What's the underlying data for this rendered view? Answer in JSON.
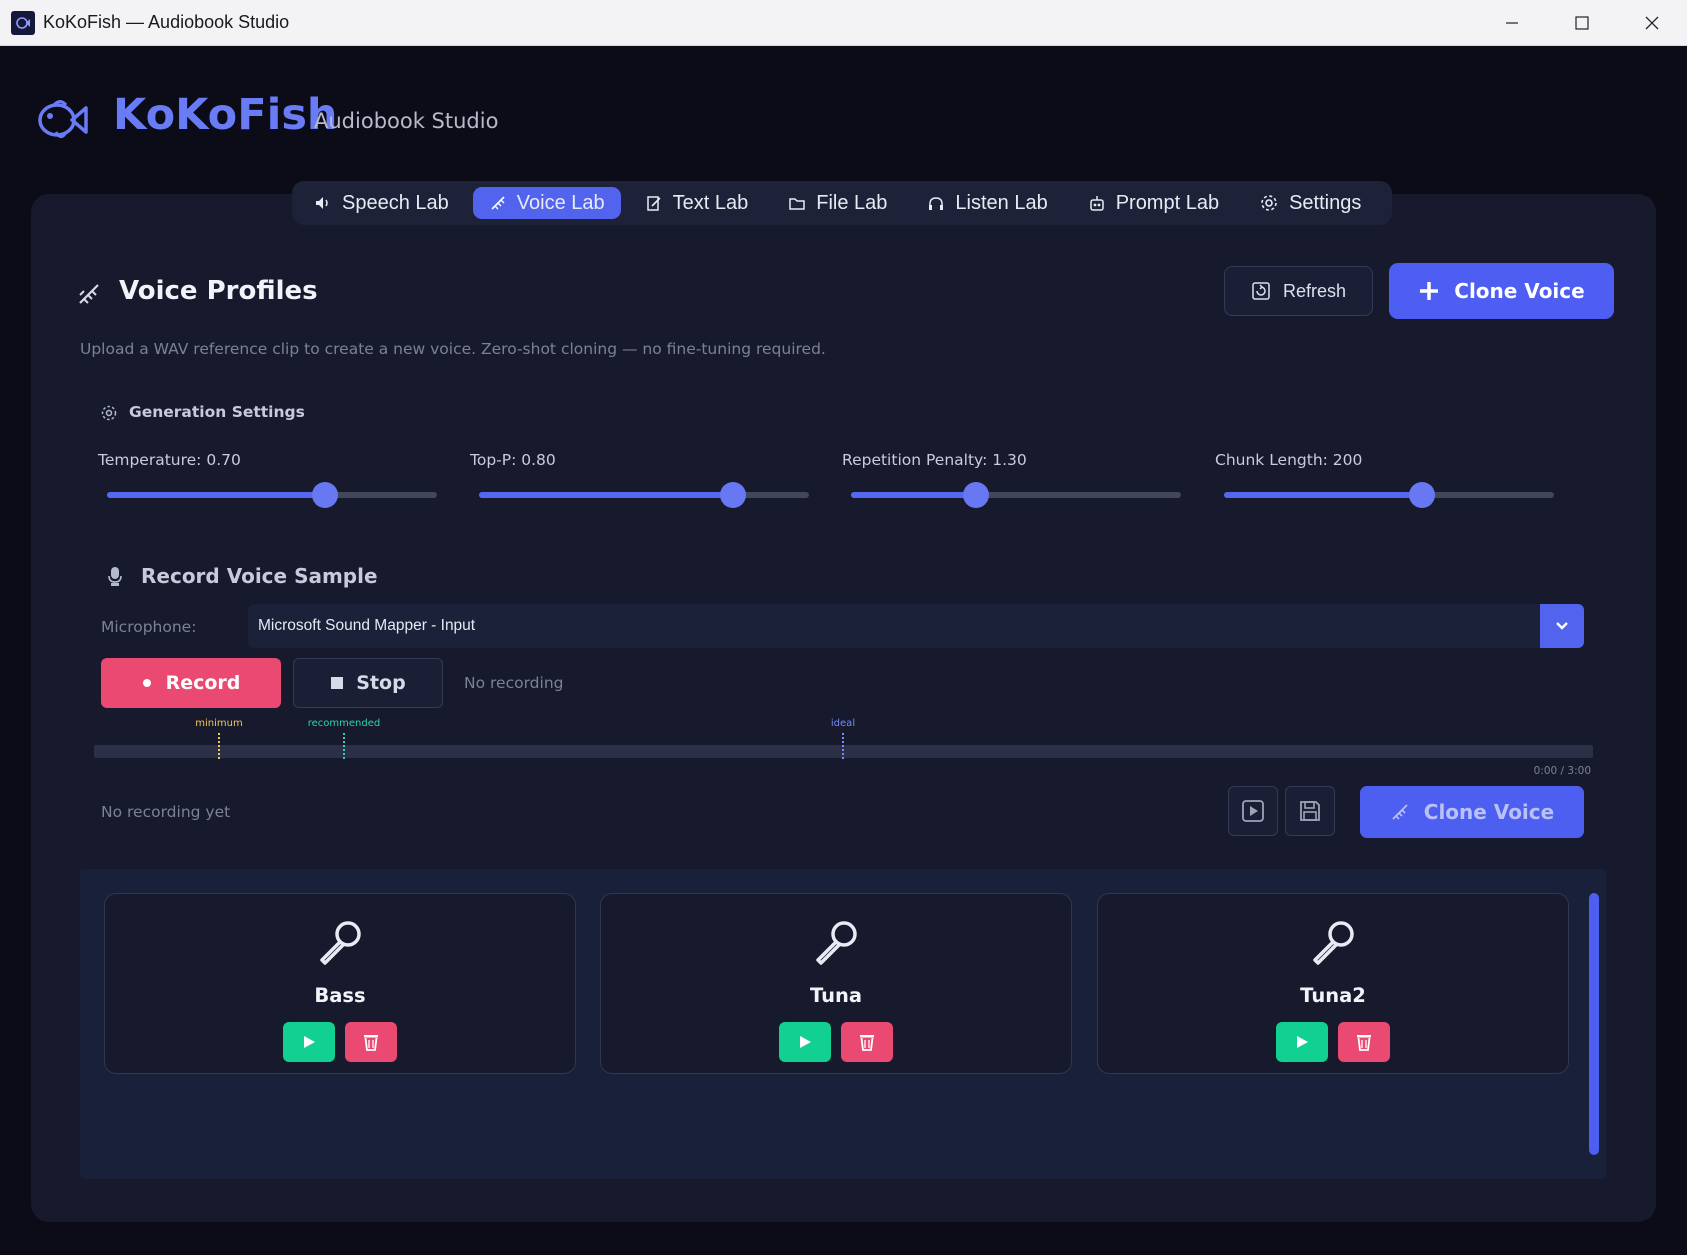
{
  "window": {
    "title": "KoKoFish — Audiobook Studio"
  },
  "brand": {
    "name": "KoKoFish",
    "subtitle": "Audiobook Studio"
  },
  "nav": {
    "tabs": [
      {
        "label": "Speech Lab",
        "icon": "speaker-icon",
        "active": false
      },
      {
        "label": "Voice Lab",
        "icon": "dna-icon",
        "active": true
      },
      {
        "label": "Text Lab",
        "icon": "edit-document-icon",
        "active": false
      },
      {
        "label": "File Lab",
        "icon": "folder-icon",
        "active": false
      },
      {
        "label": "Listen Lab",
        "icon": "headphones-icon",
        "active": false
      },
      {
        "label": "Prompt Lab",
        "icon": "robot-icon",
        "active": false
      },
      {
        "label": "Settings",
        "icon": "gear-icon",
        "active": false
      }
    ]
  },
  "section": {
    "title": "Voice Profiles",
    "description": "Upload a WAV reference clip to create a new voice. Zero-shot cloning — no fine-tuning required.",
    "refresh_label": "Refresh",
    "clone_label": "Clone Voice"
  },
  "generation": {
    "title": "Generation Settings",
    "sliders": [
      {
        "label": "Temperature: 0.70",
        "fraction": 0.66
      },
      {
        "label": "Top-P: 0.80",
        "fraction": 0.77
      },
      {
        "label": "Repetition Penalty: 1.30",
        "fraction": 0.38
      },
      {
        "label": "Chunk Length: 200",
        "fraction": 0.6
      }
    ]
  },
  "record": {
    "title": "Record Voice Sample",
    "mic_label": "Microphone:",
    "mic_value": "Microsoft Sound Mapper - Input",
    "record_label": "Record",
    "stop_label": "Stop",
    "status": "No recording",
    "markers": {
      "minimum": "minimum",
      "recommended": "recommended",
      "ideal": "ideal"
    },
    "time_readout": "0:00 / 3:00",
    "no_recording_text": "No recording yet",
    "clone_label": "Clone Voice"
  },
  "voices": [
    {
      "name": "Bass"
    },
    {
      "name": "Tuna"
    },
    {
      "name": "Tuna2"
    }
  ],
  "colors": {
    "accent": "#5264ee",
    "danger": "#ea4a72",
    "success": "#12cf92",
    "marker_minimum": "#f2c45a",
    "marker_recommended": "#2fd0b5",
    "marker_ideal": "#7a8bff"
  }
}
